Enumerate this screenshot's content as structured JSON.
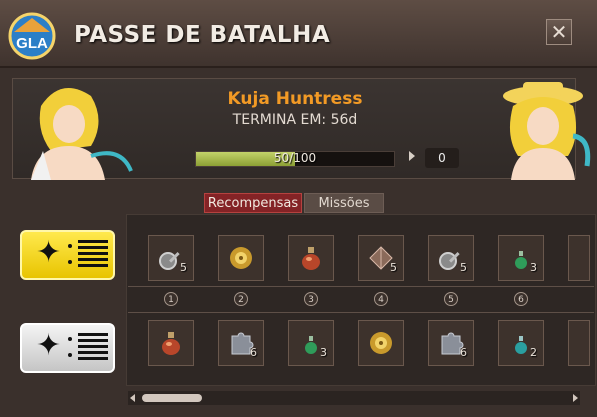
{
  "window": {
    "title": "PASSE DE BATALHA",
    "close_label": "✕",
    "logo_text": "GLA"
  },
  "banner": {
    "season_name": "Kuja Huntress",
    "ends_label": "TERMINA EM: 56d",
    "progress_text": "50/100",
    "progress_fraction": 0.5,
    "bonus_count": "0"
  },
  "tabs": {
    "rewards": "Recompensas",
    "missions": "Missões"
  },
  "tracks": {
    "premium": {
      "icon": "gold-ticket-icon"
    },
    "free": {
      "icon": "silver-ticket-icon"
    }
  },
  "levels": [
    "1",
    "2",
    "3",
    "4",
    "5",
    "6"
  ],
  "premium_rewards": [
    {
      "icon": "key-icon",
      "qty": "5"
    },
    {
      "icon": "golden-flower-icon",
      "qty": ""
    },
    {
      "icon": "potion-red-icon",
      "qty": ""
    },
    {
      "icon": "crystal-shard-icon",
      "qty": "5"
    },
    {
      "icon": "key-icon",
      "qty": "5"
    },
    {
      "icon": "potion-green-icon",
      "qty": "3"
    }
  ],
  "free_rewards": [
    {
      "icon": "potion-red-icon",
      "qty": ""
    },
    {
      "icon": "puzzle-piece-icon",
      "qty": "6"
    },
    {
      "icon": "potion-green-icon",
      "qty": "3"
    },
    {
      "icon": "golden-flower-icon",
      "qty": ""
    },
    {
      "icon": "puzzle-piece-icon",
      "qty": "6"
    },
    {
      "icon": "potion-teal-icon",
      "qty": "2"
    }
  ],
  "colors": {
    "accent": "#f29a25",
    "progress": "#a6b84a",
    "active_tab": "#842326"
  }
}
